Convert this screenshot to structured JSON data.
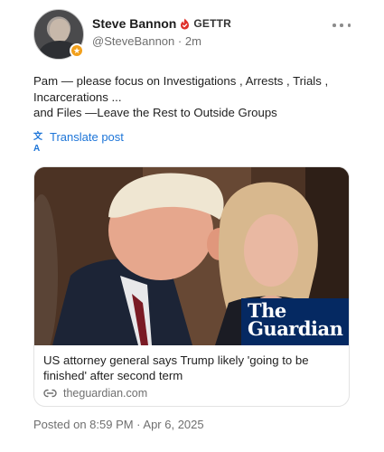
{
  "author": {
    "display_name": "Steve Bannon",
    "platform": "GETTR",
    "handle": "@SteveBannon",
    "age": "2m",
    "avatar_icon": "profile-photo",
    "badge_icon": "gold-badge-icon",
    "verified_icon": "red-verified-flame-icon"
  },
  "post": {
    "lines": [
      "Pam — please focus on Investigations , Arrests , Trials ,",
      "Incarcerations ...",
      "and Files —Leave the Rest to Outside Groups"
    ],
    "translate_label": "Translate post",
    "translate_icon": "translate-icon"
  },
  "link_card": {
    "logo_line1": "The",
    "logo_line2": "Guardian",
    "title_lines": [
      "US attorney general says Trump likely 'going to be",
      "finished' after second term"
    ],
    "domain": "theguardian.com",
    "domain_icon": "link-icon"
  },
  "footer": {
    "posted_on": "Posted on 8:59 PM · Apr 6, 2025"
  },
  "more_icon": "more-dots-icon",
  "colors": {
    "link_blue": "#1d75d8",
    "guardian_navy": "#052962",
    "verified_red": "#e0312b",
    "muted_text": "#6f6f6f"
  }
}
